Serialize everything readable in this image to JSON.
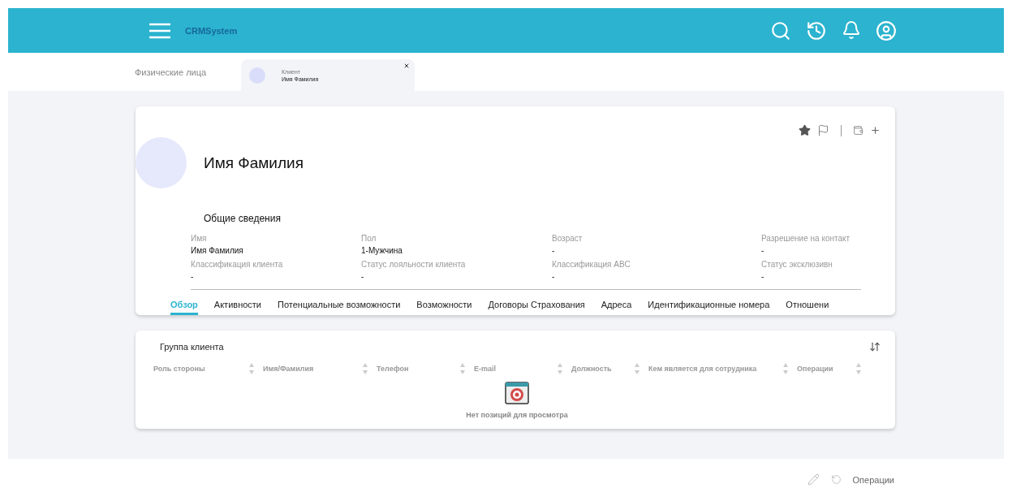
{
  "header": {
    "brand": "CRMSystem"
  },
  "breadcrumb": {
    "section": "Физические лица",
    "tab": {
      "label": "Клиент",
      "title": "Имя Фамилия",
      "selected": true
    }
  },
  "profile": {
    "name": "Имя Фамилия",
    "favorite": true,
    "section_title": "Общие сведения",
    "fields": [
      {
        "label": "Имя",
        "value": "Имя Фамилия"
      },
      {
        "label": "Пол",
        "value": "1-Мужчина"
      },
      {
        "label": "Возраст",
        "value": "-"
      },
      {
        "label": "Разрешение на контакт",
        "value": "-"
      },
      {
        "label": "Классификация клиента",
        "value": "-"
      },
      {
        "label": "Статус лояльности клиента",
        "value": "-"
      },
      {
        "label": "Классификация ABC",
        "value": "-"
      },
      {
        "label": "Статус эксклюзивн",
        "value": "-"
      }
    ],
    "tabs": [
      {
        "label": "Обзор",
        "selected": true
      },
      {
        "label": "Активности",
        "selected": false
      },
      {
        "label": "Потенциальные возможности",
        "selected": false
      },
      {
        "label": "Возможности",
        "selected": false
      },
      {
        "label": "Договоры Страхования",
        "selected": false
      },
      {
        "label": "Адреса",
        "selected": false
      },
      {
        "label": "Идентификационные номера",
        "selected": false
      },
      {
        "label": "Отношени",
        "selected": false
      }
    ]
  },
  "group": {
    "title": "Группа клиента",
    "columns": [
      "Роль стороны",
      "Имя/Фамилия",
      "Телефон",
      "E-mail",
      "Должность",
      "Кем является для сотрудника",
      "Операции"
    ],
    "empty_text": "Нет позиций для просмотра"
  },
  "footer": {
    "operations": "Операции"
  }
}
